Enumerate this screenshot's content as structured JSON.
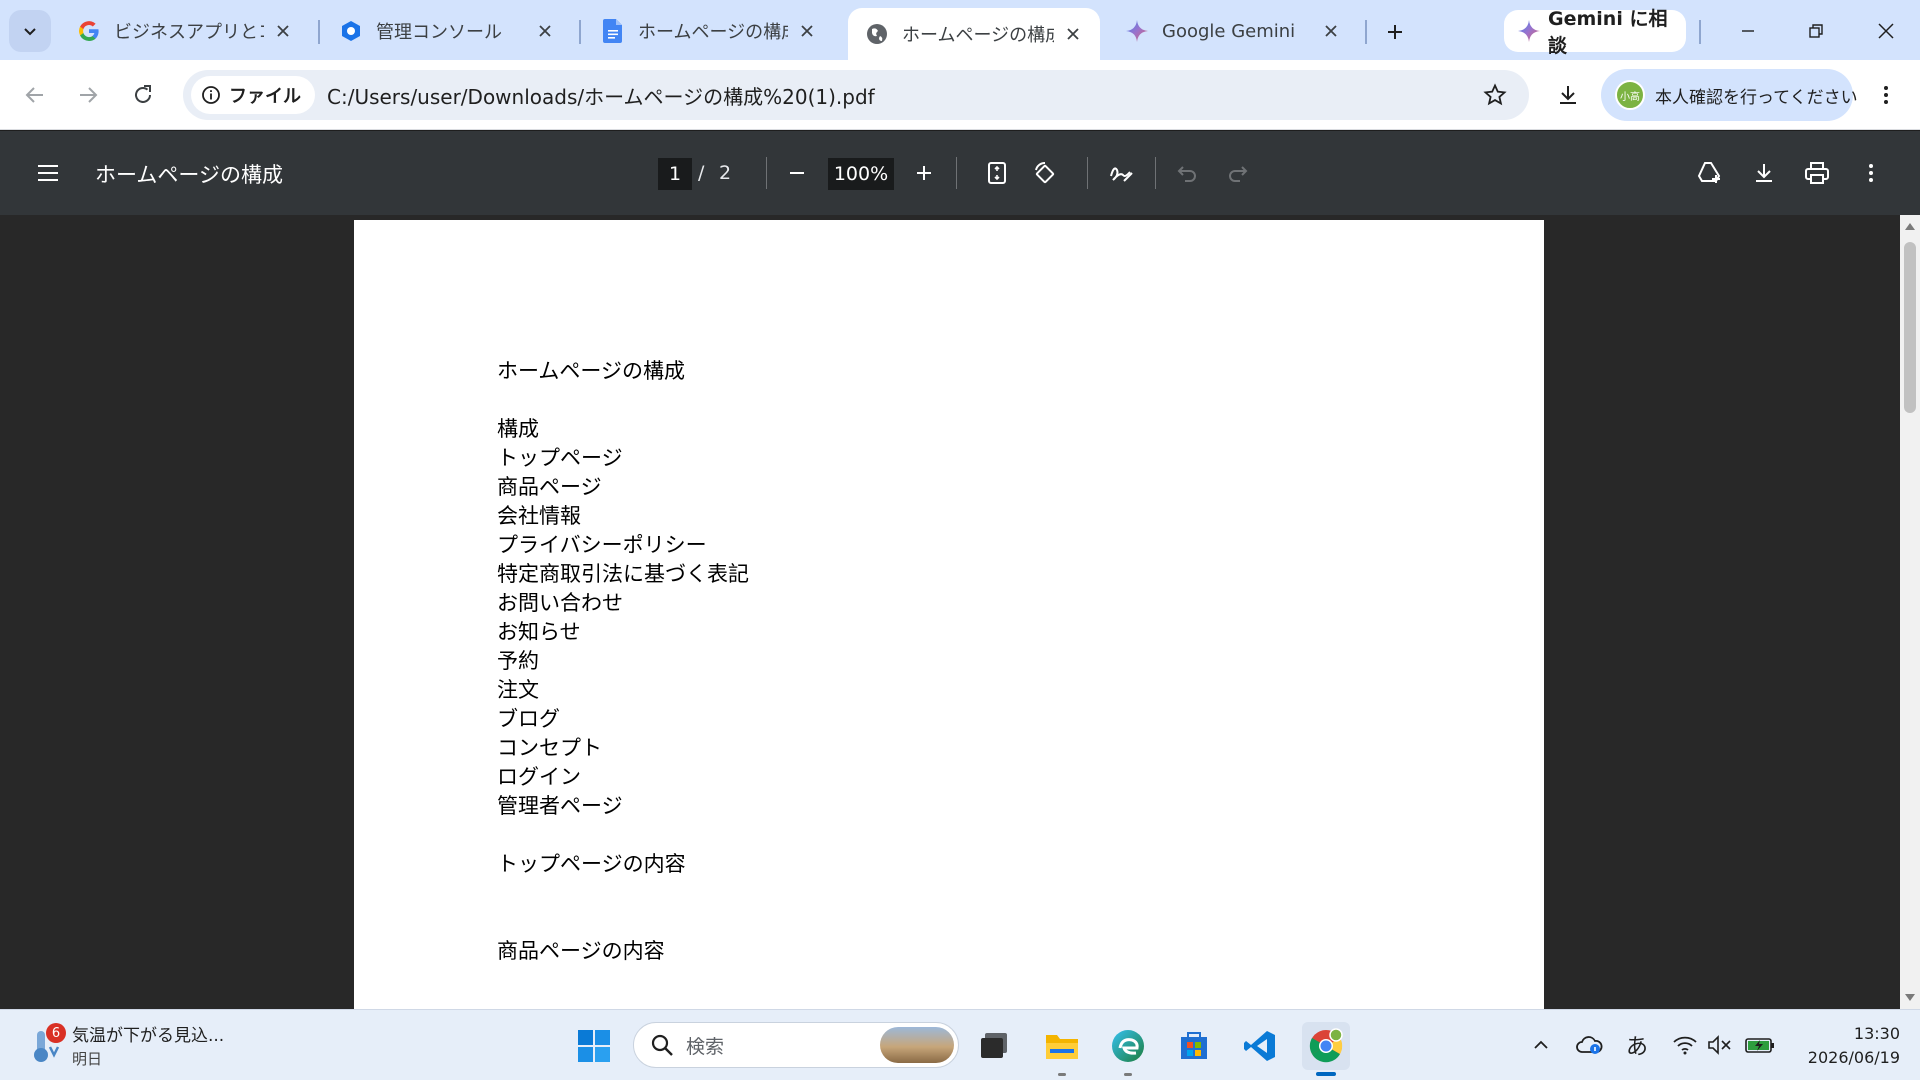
{
  "browser": {
    "tabs": [
      {
        "title": "ビジネスアプリとコラボレ",
        "icon": "google-icon"
      },
      {
        "title": "管理コンソール",
        "icon": "admin-console-icon"
      },
      {
        "title": "ホームページの構成 - G",
        "icon": "docs-icon"
      },
      {
        "title": "ホームページの構成",
        "icon": "globe-icon",
        "active": true
      },
      {
        "title": "Google Gemini",
        "icon": "gemini-icon"
      }
    ],
    "gemini_button": "Gemini に相談",
    "address": {
      "chip_label": "ファイル",
      "url": "C:/Users/user/Downloads/ホームページの構成%20(1).pdf"
    },
    "profile_chip": "本人確認を行ってください",
    "avatar_text": "小高"
  },
  "pdf_toolbar": {
    "title": "ホームページの構成",
    "current_page": "1",
    "page_separator": "/",
    "total_pages": "2",
    "zoom": "100%"
  },
  "document": {
    "heading": "ホームページの構成",
    "section_label": "構成",
    "items": [
      "トップページ",
      "商品ページ",
      "会社情報",
      "プライバシーポリシー",
      "特定商取引法に基づく表記",
      "お問い合わせ",
      "お知らせ",
      "予約",
      "注文",
      "ブログ",
      "コンセプト",
      "ログイン",
      "管理者ページ"
    ],
    "section2": "トップページの内容",
    "section3": "商品ページの内容"
  },
  "taskbar": {
    "weather_badge": "6",
    "weather_title": "気温が下がる見込...",
    "weather_sub": "明日",
    "search_placeholder": "検索",
    "ime": "あ",
    "time": "13:30",
    "date": "2026/06/19"
  },
  "colors": {
    "tabstrip": "#d3e3fd",
    "pdf_toolbar": "#323639",
    "viewer_bg": "#282828",
    "accent": "#0067c0"
  }
}
